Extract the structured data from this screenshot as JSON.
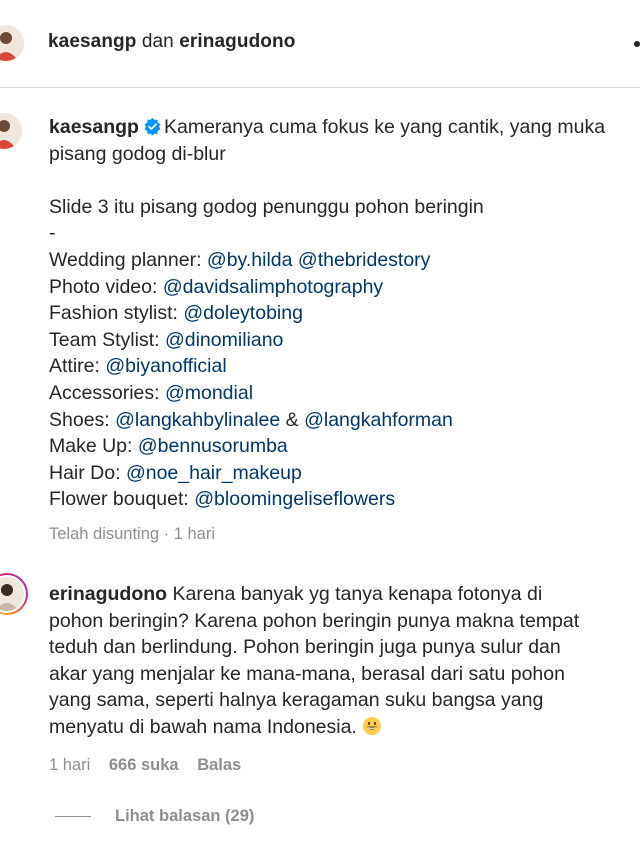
{
  "header": {
    "user1": "kaesangp",
    "conjunction": "dan",
    "user2": "erinagudono"
  },
  "caption": {
    "username": "kaesangp",
    "text_line1": "Kameranya cuma fokus ke yang cantik, yang muka",
    "text_line2": "pisang godog di-blur",
    "text_line3": "Slide 3 itu pisang godog penunggu pohon beringin",
    "dash": "-",
    "credits": [
      {
        "label": "Wedding planner: ",
        "mentions": [
          "@by.hilda",
          "@thebridestory"
        ],
        "sep": " "
      },
      {
        "label": "Photo video: ",
        "mentions": [
          "@davidsalimphotography"
        ],
        "sep": ""
      },
      {
        "label": "Fashion stylist: ",
        "mentions": [
          "@doleytobing"
        ],
        "sep": ""
      },
      {
        "label": "Team Stylist: ",
        "mentions": [
          "@dinomiliano"
        ],
        "sep": ""
      },
      {
        "label": "Attire: ",
        "mentions": [
          "@biyanofficial"
        ],
        "sep": ""
      },
      {
        "label": "Accessories: ",
        "mentions": [
          "@mondial"
        ],
        "sep": ""
      },
      {
        "label": "Shoes: ",
        "mentions": [
          "@langkahbylinalee",
          "@langkahforman"
        ],
        "sep": " & "
      },
      {
        "label": "Make Up: ",
        "mentions": [
          "@bennusorumba"
        ],
        "sep": ""
      },
      {
        "label": "Hair Do: ",
        "mentions": [
          "@noe_hair_makeup"
        ],
        "sep": ""
      },
      {
        "label": "Flower bouquet: ",
        "mentions": [
          "@bloomingeliseflowers"
        ],
        "sep": ""
      }
    ],
    "meta": "Telah disunting · 1 hari"
  },
  "comment": {
    "username": "erinagudono",
    "text_line1": " Karena banyak yg tanya kenapa fotonya di",
    "text_line2": "pohon beringin? Karena pohon beringin punya makna tempat",
    "text_line3": "teduh dan berlindung. Pohon beringin juga punya sulur dan",
    "text_line4": "akar yang menjalar ke mana-mana, berasal dari satu pohon",
    "text_line5": "yang sama, seperti halnya keragaman suku bangsa yang",
    "text_line6": "menyatu di bawah nama Indonesia. ",
    "emoji": "grinning-face-emoji",
    "time": "1 hari",
    "likes": "666 suka",
    "reply": "Balas"
  },
  "replies": {
    "label": "Lihat balasan (29)"
  },
  "colors": {
    "mention": "#00376b",
    "verified": "#0095f6",
    "secondary": "#8e8e8e",
    "primary": "#262626"
  }
}
